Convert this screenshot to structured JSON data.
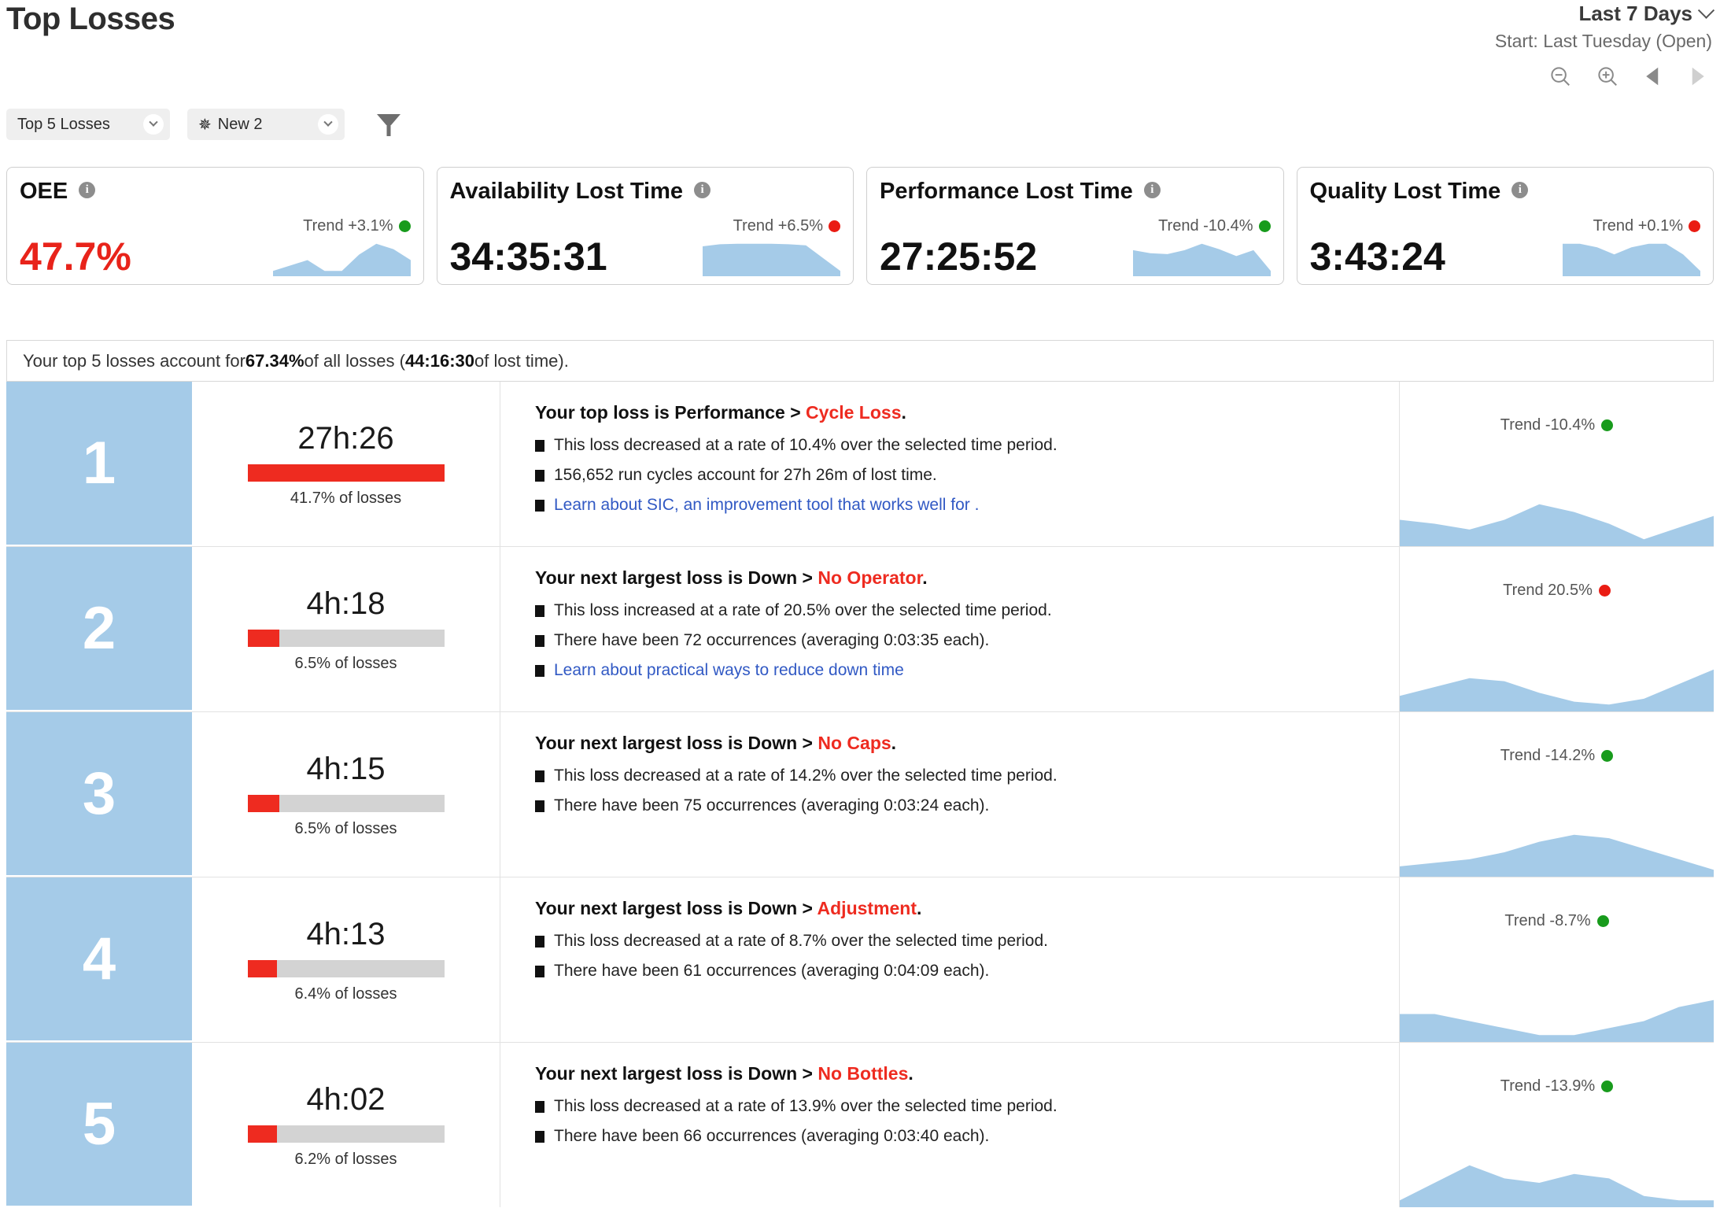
{
  "header": {
    "title": "Top Losses",
    "range_label": "Last 7 Days",
    "range_sub": "Start: Last Tuesday (Open)",
    "icons": {
      "zoom_out": "zoom-out-icon",
      "zoom_in": "zoom-in-icon",
      "prev": "previous-arrow-icon",
      "next": "next-arrow-icon"
    }
  },
  "filters": {
    "view_select": "Top 5 Losses",
    "config_select": "New 2",
    "filter_icon": "funnel-icon"
  },
  "kpis": [
    {
      "title": "OEE",
      "value": "47.7%",
      "value_color": "#e8231a",
      "trend": "Trend +3.1%",
      "trend_status": "green"
    },
    {
      "title": "Availability Lost Time",
      "value": "34:35:31",
      "value_color": "#111111",
      "trend": "Trend +6.5%",
      "trend_status": "red"
    },
    {
      "title": "Performance Lost Time",
      "value": "27:25:52",
      "value_color": "#111111",
      "trend": "Trend -10.4%",
      "trend_status": "green"
    },
    {
      "title": "Quality Lost Time",
      "value": "3:43:24",
      "value_color": "#111111",
      "trend": "Trend +0.1%",
      "trend_status": "red"
    }
  ],
  "summary": {
    "prefix": "Your top 5 losses account for ",
    "percent": "67.34%",
    "middle": " of all losses (",
    "time": "44:16:30",
    "suffix": " of lost time)."
  },
  "rows": [
    {
      "rank": "1",
      "time": "27h:26",
      "pct_label": "41.7% of losses",
      "bar_pct": 100,
      "head_prefix": "Your top loss is Performance > ",
      "head_category": "Cycle Loss",
      "head_suffix": ".",
      "bullets": [
        {
          "text": "This loss decreased at a rate of 10.4% over the selected time period.",
          "link": false
        },
        {
          "text": "156,652 run cycles account for 27h 26m of lost time.",
          "link": false
        },
        {
          "text": "Learn about SIC, an improvement tool that works well for .",
          "link": true
        }
      ],
      "trend": "Trend -10.4%",
      "trend_status": "green"
    },
    {
      "rank": "2",
      "time": "4h:18",
      "pct_label": "6.5% of losses",
      "bar_pct": 16,
      "head_prefix": "Your next largest loss is Down > ",
      "head_category": "No Operator",
      "head_suffix": ".",
      "bullets": [
        {
          "text": "This loss increased at a rate of 20.5% over the selected time period.",
          "link": false
        },
        {
          "text": "There have been 72 occurrences (averaging 0:03:35 each).",
          "link": false
        },
        {
          "text": "Learn about practical ways to reduce down time",
          "link": true
        }
      ],
      "trend": "Trend 20.5%",
      "trend_status": "red"
    },
    {
      "rank": "3",
      "time": "4h:15",
      "pct_label": "6.5% of losses",
      "bar_pct": 16,
      "head_prefix": "Your next largest loss is Down > ",
      "head_category": "No Caps",
      "head_suffix": ".",
      "bullets": [
        {
          "text": "This loss decreased at a rate of 14.2% over the selected time period.",
          "link": false
        },
        {
          "text": "There have been 75 occurrences (averaging 0:03:24 each).",
          "link": false
        }
      ],
      "trend": "Trend -14.2%",
      "trend_status": "green"
    },
    {
      "rank": "4",
      "time": "4h:13",
      "pct_label": "6.4% of losses",
      "bar_pct": 15,
      "head_prefix": "Your next largest loss is Down > ",
      "head_category": "Adjustment",
      "head_suffix": ".",
      "bullets": [
        {
          "text": "This loss decreased at a rate of 8.7% over the selected time period.",
          "link": false
        },
        {
          "text": "There have been 61 occurrences (averaging 0:04:09 each).",
          "link": false
        }
      ],
      "trend": "Trend -8.7%",
      "trend_status": "green"
    },
    {
      "rank": "5",
      "time": "4h:02",
      "pct_label": "6.2% of losses",
      "bar_pct": 15,
      "head_prefix": "Your next largest loss is Down > ",
      "head_category": "No Bottles",
      "head_suffix": ".",
      "bullets": [
        {
          "text": "This loss decreased at a rate of 13.9% over the selected time period.",
          "link": false
        },
        {
          "text": "There have been 66 occurrences (averaging 0:03:40 each).",
          "link": false
        }
      ],
      "trend": "Trend -13.9%",
      "trend_status": "green"
    }
  ],
  "chart_data": {
    "type": "area",
    "title": "Sparkline trends",
    "series": [
      {
        "name": "OEE",
        "values": [
          62,
          64,
          66,
          62,
          62,
          68,
          72,
          70,
          66
        ]
      },
      {
        "name": "Availability Lost Time",
        "values": [
          78,
          82,
          83,
          83,
          83,
          82,
          80,
          55,
          30
        ]
      },
      {
        "name": "Performance Lost Time",
        "values": [
          72,
          66,
          64,
          72,
          85,
          74,
          60,
          72,
          30
        ]
      },
      {
        "name": "Quality Lost Time",
        "values": [
          80,
          80,
          74,
          62,
          74,
          80,
          80,
          62,
          34
        ]
      },
      {
        "name": "Cycle Loss trend",
        "values": [
          62,
          60,
          57,
          62,
          70,
          66,
          60,
          52,
          58,
          64
        ]
      },
      {
        "name": "No Operator trend",
        "values": [
          50,
          56,
          62,
          60,
          52,
          46,
          44,
          48,
          58,
          68
        ]
      },
      {
        "name": "No Caps trend",
        "values": [
          48,
          50,
          52,
          56,
          62,
          66,
          64,
          58,
          52,
          46
        ]
      },
      {
        "name": "Adjustment trend",
        "values": [
          56,
          56,
          54,
          52,
          50,
          50,
          52,
          54,
          58,
          60
        ]
      },
      {
        "name": "No Bottles trend",
        "values": [
          50,
          58,
          66,
          60,
          58,
          62,
          60,
          52,
          50,
          50
        ]
      }
    ],
    "ylabel": "",
    "xlabel": "",
    "grid": false,
    "legend": "none",
    "area_color": "#a5cbe8"
  }
}
